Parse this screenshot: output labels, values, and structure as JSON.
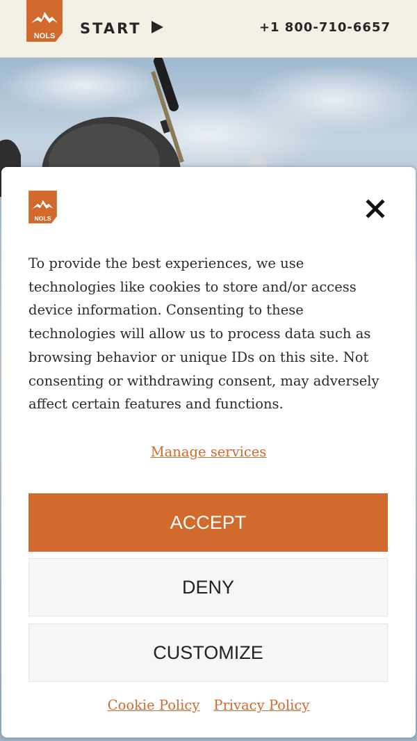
{
  "header": {
    "logo_text": "NOLS",
    "start_label": "START",
    "phone": "+1 800-710-6657"
  },
  "consent": {
    "logo_text": "NOLS",
    "message": "To provide the best experiences, we use technologies like cookies to store and/or access device information. Consenting to these technologies will allow us to process data such as browsing behavior or unique IDs on this site. Not consenting or withdrawing consent, may adversely affect certain features and functions.",
    "manage_services": "Manage services",
    "accept_label": "ACCEPT",
    "deny_label": "DENY",
    "customize_label": "CUSTOMIZE",
    "cookie_policy": "Cookie Policy",
    "privacy_policy": "Privacy Policy"
  },
  "icons": {
    "logo": "nols-mountain-logo",
    "start": "play-icon",
    "close": "close-icon"
  },
  "colors": {
    "brand": "#d16a2c",
    "link": "#cf6a2e",
    "header_bg": "#f4f0e6"
  }
}
